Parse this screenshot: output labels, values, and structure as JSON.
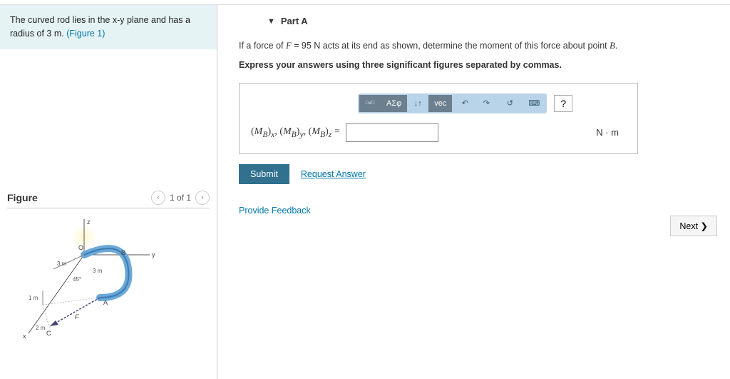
{
  "intro": {
    "text_before": "The curved rod lies in the x-y plane and has a radius of 3 ",
    "unit": "m",
    "text_after": ". ",
    "figure_link": "(Figure 1)"
  },
  "figure": {
    "title": "Figure",
    "counter": "1 of 1",
    "labels": {
      "z": "z",
      "y": "y",
      "x": "x",
      "O": "O",
      "B": "B",
      "A": "A",
      "F": "F",
      "C": "C",
      "r_top": "3 m",
      "r_arc": "3 m",
      "ang": "45°",
      "h": "1 m",
      "d": "2 m"
    }
  },
  "part": {
    "label": "Part A",
    "q1": "If a force of ",
    "var": "F",
    "eq": " = 95 ",
    "unitN": "N",
    "q2": " acts at its end as shown, determine the moment of this force about point ",
    "pointB": "B",
    "q3": ".",
    "instruct": "Express your answers using three significant figures separated by commas."
  },
  "toolbar": {
    "templates": "√",
    "greek": "ΑΣφ",
    "arrows": "↓↑",
    "vec": "vec",
    "undo": "↶",
    "redo": "↷",
    "reset": "↺",
    "keyboard": "⌨",
    "help": "?"
  },
  "answer": {
    "label": "(M_B)_x, (M_B)_y, (M_B)_z =",
    "unit": "N · m",
    "value": ""
  },
  "buttons": {
    "submit": "Submit",
    "request": "Request Answer",
    "feedback": "Provide Feedback",
    "next": "Next ❯"
  }
}
